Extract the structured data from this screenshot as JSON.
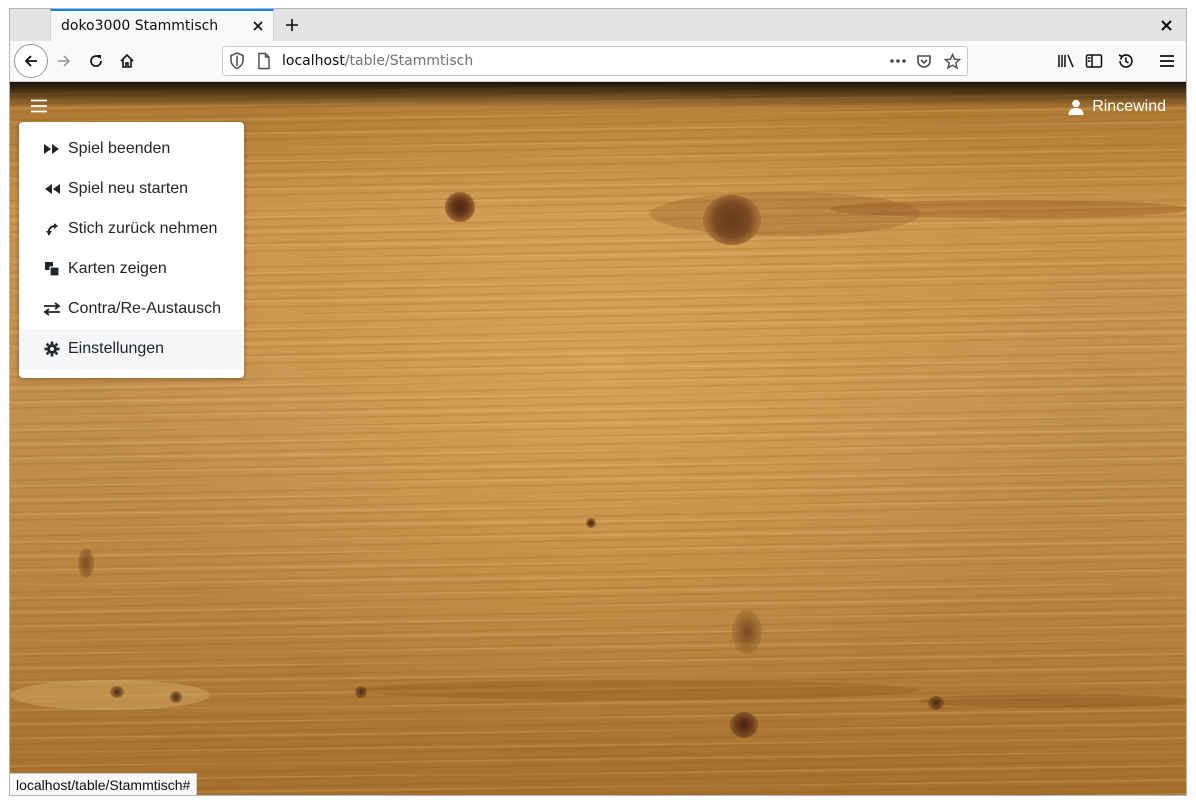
{
  "browser": {
    "tab_title": "doko3000 Stammtisch",
    "url_host": "localhost",
    "url_path": "/table/Stammtisch",
    "status_url": "localhost/table/Stammtisch#"
  },
  "app": {
    "user_name": "Rincewind",
    "menu": [
      {
        "label": "Spiel beenden",
        "icon": "fast-forward-icon"
      },
      {
        "label": "Spiel neu starten",
        "icon": "rewind-icon"
      },
      {
        "label": "Stich zurück nehmen",
        "icon": "undo-icon"
      },
      {
        "label": "Karten zeigen",
        "icon": "cards-icon"
      },
      {
        "label": "Contra/Re-Austausch",
        "icon": "exchange-icon"
      },
      {
        "label": "Einstellungen",
        "icon": "gear-icon"
      }
    ]
  },
  "colors": {
    "tab_accent": "#0a84ff",
    "menu_hover": "#f5f6f8",
    "wood": "#c3914e"
  }
}
